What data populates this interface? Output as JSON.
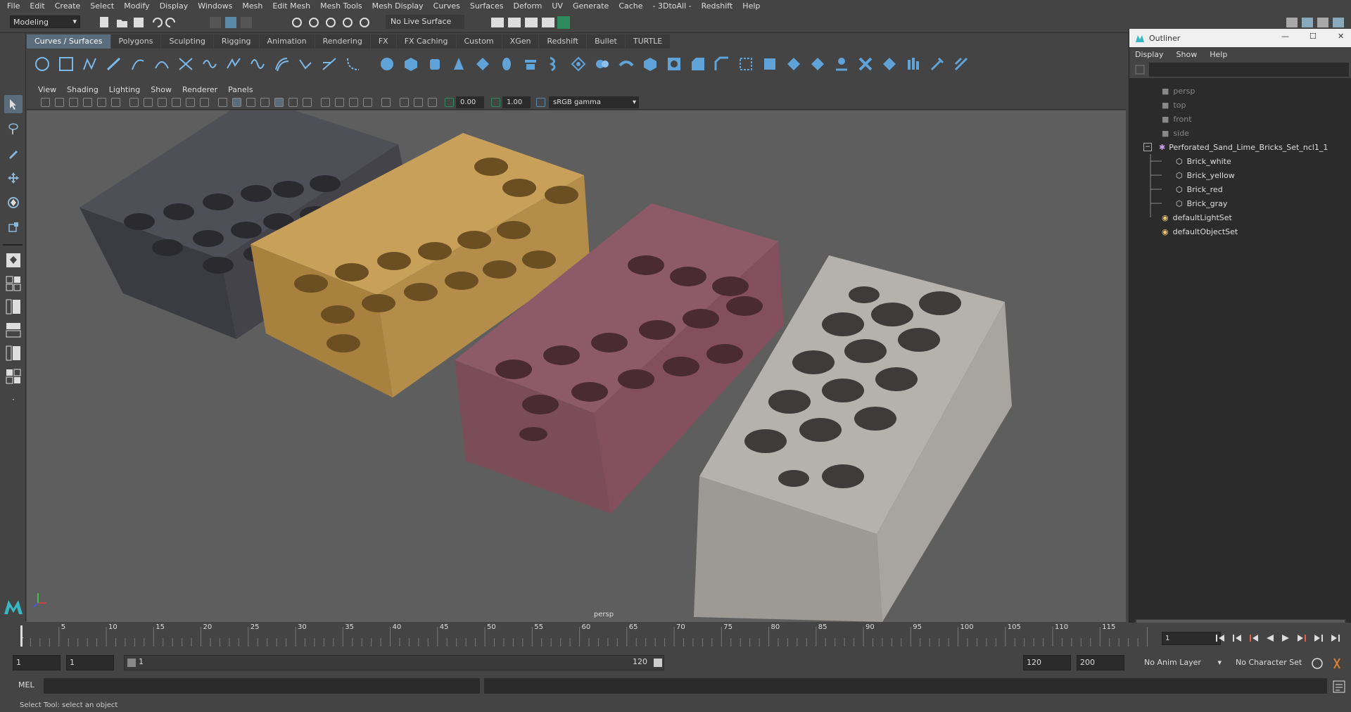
{
  "menubar": {
    "items": [
      "File",
      "Edit",
      "Create",
      "Select",
      "Modify",
      "Display",
      "Windows",
      "Mesh",
      "Edit Mesh",
      "Mesh Tools",
      "Mesh Display",
      "Curves",
      "Surfaces",
      "Deform",
      "UV",
      "Generate",
      "Cache",
      "- 3DtoAll -",
      "Redshift",
      "Help"
    ]
  },
  "statusline": {
    "mode": "Modeling",
    "live_surface": "No Live Surface"
  },
  "shelf": {
    "tabs": [
      "Curves / Surfaces",
      "Polygons",
      "Sculpting",
      "Rigging",
      "Animation",
      "Rendering",
      "FX",
      "FX Caching",
      "Custom",
      "XGen",
      "Redshift",
      "Bullet",
      "TURTLE"
    ],
    "active_tab": "Curves / Surfaces"
  },
  "panel": {
    "menus": [
      "View",
      "Shading",
      "Lighting",
      "Show",
      "Renderer",
      "Panels"
    ],
    "exposure": "0.00",
    "gamma": "1.00",
    "color_space": "sRGB gamma",
    "camera_label": "persp"
  },
  "outliner": {
    "title": "Outliner",
    "menus": [
      "Display",
      "Show",
      "Help"
    ],
    "cameras": [
      "persp",
      "top",
      "front",
      "side"
    ],
    "group": "Perforated_Sand_Lime_Bricks_Set_ncl1_1",
    "children": [
      "Brick_white",
      "Brick_yellow",
      "Brick_red",
      "Brick_gray"
    ],
    "sets": [
      "defaultLightSet",
      "defaultObjectSet"
    ]
  },
  "timeline": {
    "ticks": [
      "5",
      "10",
      "15",
      "20",
      "25",
      "30",
      "35",
      "40",
      "45",
      "50",
      "55",
      "60",
      "65",
      "70",
      "75",
      "80",
      "85",
      "90",
      "95",
      "100",
      "105",
      "110",
      "115"
    ],
    "start_marker": "1",
    "current_frame": "1"
  },
  "range": {
    "start": "1",
    "playback_start": "1",
    "slider_start": "1",
    "slider_end": "120",
    "playback_end": "120",
    "end": "200",
    "anim_layer": "No Anim Layer",
    "character_set": "No Character Set"
  },
  "cmdline": {
    "label": "MEL"
  },
  "helpline": {
    "text": "Select Tool: select an object"
  },
  "colors": {
    "brick_gray": "#4a4a52",
    "brick_yellow": "#c29a50",
    "brick_red": "#8a5a66",
    "brick_white": "#b3b0ac",
    "viewport_bg": "#5e5e5e",
    "accent_blue": "#5b6d7d"
  }
}
